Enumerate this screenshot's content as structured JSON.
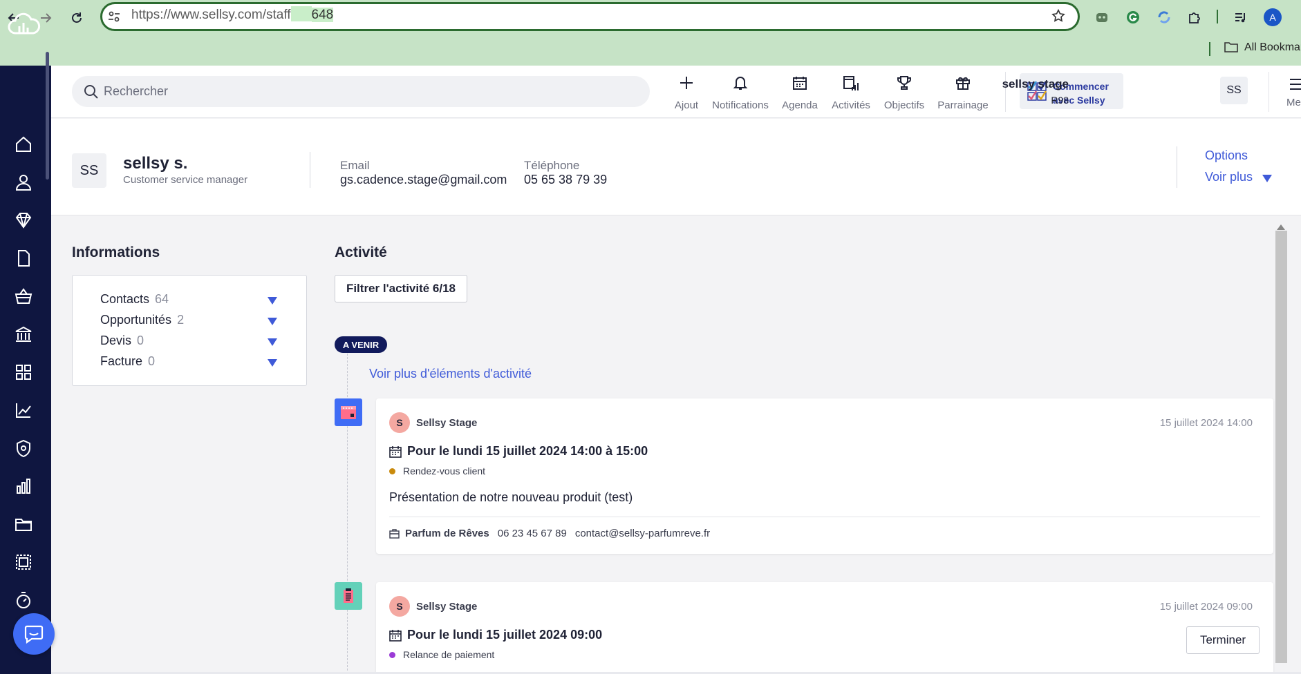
{
  "browser": {
    "url_prefix": "https://www.sellsy.com/staff",
    "url_suffix": "648",
    "bookmarks_label": "All Bookmar"
  },
  "header": {
    "search_placeholder": "Rechercher",
    "tools": [
      {
        "label": "Ajout",
        "icon": "plus-icon"
      },
      {
        "label": "Notifications",
        "icon": "bell-icon"
      },
      {
        "label": "Agenda",
        "icon": "calendar-icon"
      },
      {
        "label": "Activités",
        "icon": "activity-icon"
      },
      {
        "label": "Objectifs",
        "icon": "trophy-icon"
      },
      {
        "label": "Parrainage",
        "icon": "gift-icon"
      }
    ],
    "start_label_1": "Commencer",
    "start_label_2": "avec Sellsy",
    "user_name": "sellsy stage",
    "user_id": "R98",
    "user_initials": "SS",
    "menu_label": "Me"
  },
  "profile": {
    "initials": "SS",
    "name": "sellsy s.",
    "role": "Customer service manager",
    "email_label": "Email",
    "email": "gs.cadence.stage@gmail.com",
    "phone_label": "Téléphone",
    "phone": "05 65 38 79 39",
    "options_label": "Options",
    "voir_plus_label": "Voir plus"
  },
  "informations": {
    "title": "Informations",
    "rows": [
      {
        "label": "Contacts",
        "count": "64"
      },
      {
        "label": "Opportunités",
        "count": "2"
      },
      {
        "label": "Devis",
        "count": "0"
      },
      {
        "label": "Facture",
        "count": "0"
      }
    ]
  },
  "activite": {
    "title": "Activité",
    "filter_label": "Filtrer l'activité 6/18",
    "badge": "A VENIR",
    "more_link": "Voir plus d'éléments d'activité",
    "cards": [
      {
        "avatar": "S",
        "author": "Sellsy Stage",
        "date": "15 juillet 2024 14:00",
        "when": "Pour le lundi 15 juillet 2024 14:00 à 15:00",
        "type": "Rendez-vous client",
        "type_color": "#c98a0c",
        "description": "Présentation de notre nouveau produit (test)",
        "company": "Parfum de Rêves",
        "phone": "06 23 45 67 89",
        "email": "contact@sellsy-parfumreve.fr"
      },
      {
        "avatar": "S",
        "author": "Sellsy Stage",
        "date": "15 juillet 2024 09:00",
        "when": "Pour le lundi 15 juillet 2024 09:00",
        "type": "Relance de paiement",
        "type_color": "#9b3ad6",
        "action_label": "Terminer"
      }
    ]
  },
  "colors": {
    "rail": "#0f1640",
    "accent": "#3f5ad8",
    "badge": "#111a5c"
  }
}
